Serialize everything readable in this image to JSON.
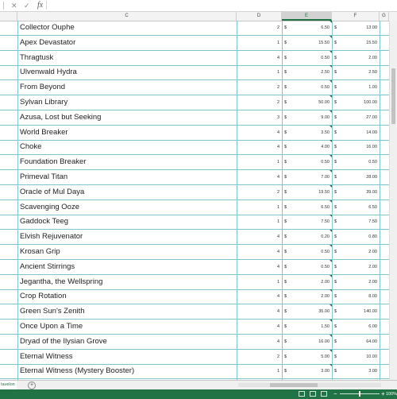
{
  "formula_bar": {
    "cancel_icon": "✕",
    "enter_icon": "✓",
    "fx_label": "fx",
    "value": ""
  },
  "columns": [
    "C",
    "D",
    "E",
    "F",
    "G"
  ],
  "rows": [
    {
      "name": "Collector Ouphe",
      "qty": "2",
      "price": "6.50",
      "total": "13.00"
    },
    {
      "name": "Apex Devastator",
      "qty": "1",
      "price": "15.50",
      "total": "15.50"
    },
    {
      "name": "Thragtusk",
      "qty": "4",
      "price": "0.50",
      "total": "2.00"
    },
    {
      "name": "Ulvenwald Hydra",
      "qty": "1",
      "price": "2.50",
      "total": "2.50"
    },
    {
      "name": "From Beyond",
      "qty": "2",
      "price": "0.50",
      "total": "1.00"
    },
    {
      "name": "Sylvan Library",
      "qty": "2",
      "price": "50.00",
      "total": "100.00"
    },
    {
      "name": "Azusa, Lost but Seeking",
      "qty": "3",
      "price": "9.00",
      "total": "27.00"
    },
    {
      "name": "World Breaker",
      "qty": "4",
      "price": "3.50",
      "total": "14.00"
    },
    {
      "name": "Choke",
      "qty": "4",
      "price": "4.00",
      "total": "16.00"
    },
    {
      "name": "Foundation Breaker",
      "qty": "1",
      "price": "0.50",
      "total": "0.50"
    },
    {
      "name": "Primeval Titan",
      "qty": "4",
      "price": "7.00",
      "total": "28.00"
    },
    {
      "name": "Oracle of Mul Daya",
      "qty": "2",
      "price": "19.50",
      "total": "39.00"
    },
    {
      "name": "Scavenging Ooze",
      "qty": "1",
      "price": "6.50",
      "total": "6.50"
    },
    {
      "name": "Gaddock Teeg",
      "qty": "1",
      "price": "7.50",
      "total": "7.50"
    },
    {
      "name": "Elvish Rejuvenator",
      "qty": "4",
      "price": "0.20",
      "total": "0.80"
    },
    {
      "name": "Krosan Grip",
      "qty": "4",
      "price": "0.50",
      "total": "2.00"
    },
    {
      "name": "Ancient Stirrings",
      "qty": "4",
      "price": "0.50",
      "total": "2.00"
    },
    {
      "name": "Jegantha, the Wellspring",
      "qty": "1",
      "price": "2.00",
      "total": "2.00"
    },
    {
      "name": "Crop Rotation",
      "qty": "4",
      "price": "2.00",
      "total": "8.00"
    },
    {
      "name": "Green Sun's Zenith",
      "qty": "4",
      "price": "35.00",
      "total": "140.00"
    },
    {
      "name": "Once Upon a Time",
      "qty": "4",
      "price": "1.50",
      "total": "6.00"
    },
    {
      "name": "Dryad of the Ilysian Grove",
      "qty": "4",
      "price": "16.00",
      "total": "64.00"
    },
    {
      "name": "Eternal Witness",
      "qty": "2",
      "price": "5.00",
      "total": "10.00"
    },
    {
      "name": "Eternal Witness (Mystery Booster)",
      "qty": "1",
      "price": "3.00",
      "total": "3.00"
    }
  ],
  "currency_symbol": "$",
  "sheet_tab": "Iavelon",
  "add_sheet_icon": "+",
  "status": {
    "zoom_minus": "−",
    "zoom_plus": "+",
    "zoom": "100%"
  },
  "colors": {
    "accent": "#217346",
    "gridline": "#7fc5cf"
  }
}
